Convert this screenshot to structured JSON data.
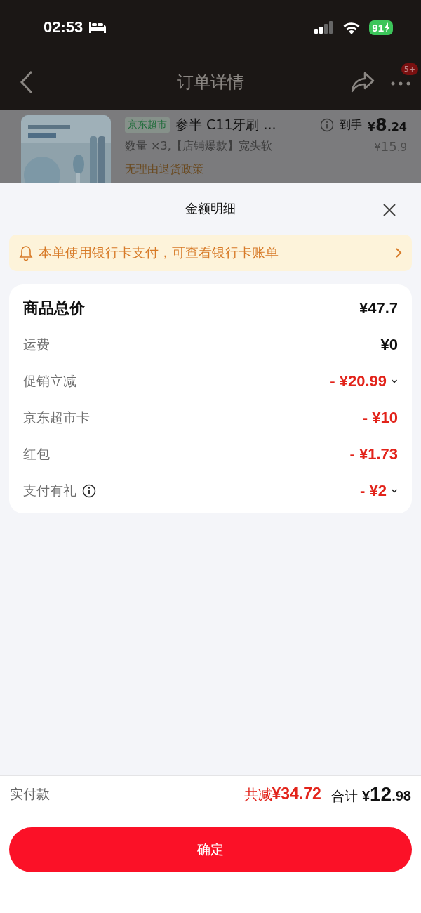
{
  "status_bar": {
    "time": "02:53",
    "battery": "91"
  },
  "nav": {
    "title": "订单详情",
    "badge": "5+"
  },
  "product": {
    "tag": "京东超市",
    "title": "参半 C11牙刷 ...",
    "price_label": "到手",
    "price": {
      "currency": "¥",
      "integer": "8",
      "decimal": ".24"
    },
    "original_price": {
      "currency": "¥",
      "integer": "15",
      "decimal": ".9"
    },
    "spec": "数量 ×3,【店铺爆款】宽头软",
    "policy": "无理由退货政策"
  },
  "sheet": {
    "title": "金额明细",
    "notice": "本单使用银行卡支付，可查看银行卡账单",
    "rows": [
      {
        "kind": "total",
        "label": "商品总价",
        "amount": "¥47.7",
        "info": false,
        "dropdown": false
      },
      {
        "kind": "neutral",
        "label": "运费",
        "amount": "¥0",
        "info": false,
        "dropdown": false
      },
      {
        "kind": "discount",
        "label": "促销立减",
        "amount": "- ¥20.99",
        "info": false,
        "dropdown": true
      },
      {
        "kind": "discount",
        "label": "京东超市卡",
        "amount": "- ¥10",
        "info": false,
        "dropdown": false
      },
      {
        "kind": "discount",
        "label": "红包",
        "amount": "- ¥1.73",
        "info": false,
        "dropdown": false
      },
      {
        "kind": "discount",
        "label": "支付有礼",
        "amount": "- ¥2",
        "info": true,
        "dropdown": true
      }
    ],
    "footer": {
      "label": "实付款",
      "saved_label": "共减",
      "saved": "¥34.72",
      "total_label": "合计",
      "total": {
        "currency": "¥",
        "integer": "12",
        "decimal": ".98"
      }
    },
    "confirm": "确定"
  }
}
